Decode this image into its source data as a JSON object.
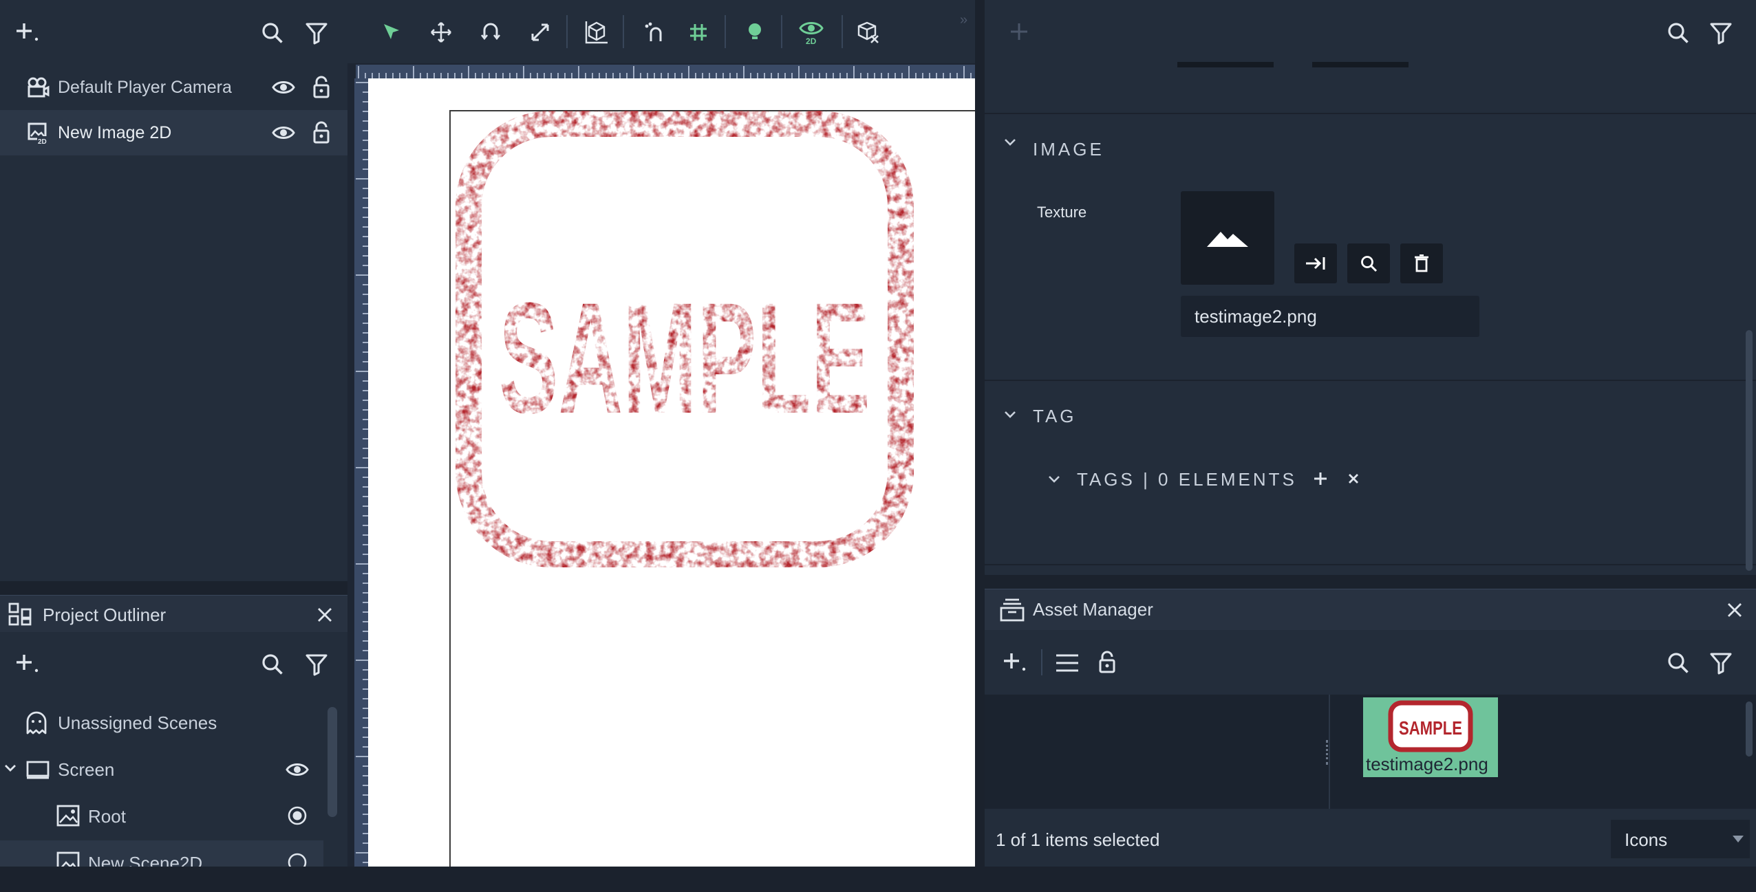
{
  "scene_hierarchy": {
    "items": [
      {
        "label": "Default Player Camera",
        "icon": "camera-icon"
      },
      {
        "label": "New Image 2D",
        "icon": "image-2d-icon"
      }
    ]
  },
  "project_outliner": {
    "title": "Project Outliner",
    "items": [
      {
        "label": "Unassigned Scenes",
        "icon": "ghost-icon"
      },
      {
        "label": "Screen",
        "icon": "monitor-icon"
      },
      {
        "label": "Root",
        "icon": "image-icon"
      },
      {
        "label": "New Scene2D",
        "icon": "image-icon"
      }
    ]
  },
  "viewport": {
    "toolbar_icons": [
      "select-arrow-icon",
      "move-icon",
      "rotate-icon",
      "scale-icon",
      "bounding-box-icon",
      "snap-icon",
      "grid-icon",
      "light-bulb-icon",
      "view-2d-icon",
      "hide-gizmo-icon"
    ],
    "stamp_text": "SAMPLE",
    "colors": {
      "accent_green": "#6fcf97",
      "stamp_red": "#b3262d"
    }
  },
  "inspector": {
    "image_section": "IMAGE",
    "texture_label": "Texture",
    "texture_file": "testimage2.png",
    "tag_section": "TAG",
    "tags_header": "TAGS | 0 ELEMENTS"
  },
  "asset_manager": {
    "title": "Asset Manager",
    "asset_name": "testimage2.png",
    "asset_thumb_text": "SAMPLE",
    "status": "1 of 1 items selected",
    "view_mode": "Icons"
  }
}
